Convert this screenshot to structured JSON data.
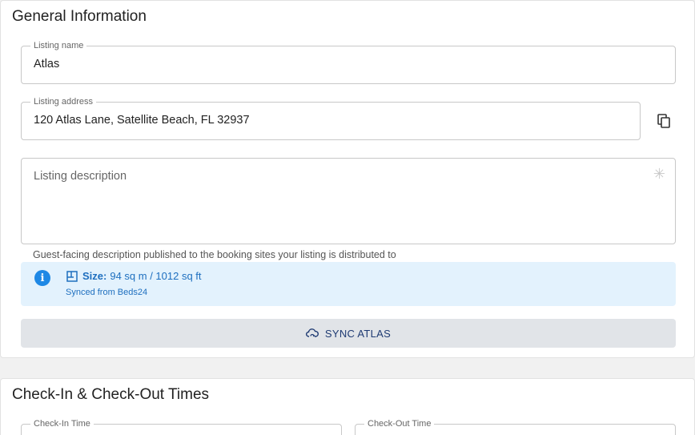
{
  "general": {
    "title": "General Information",
    "listing_name": {
      "label": "Listing name",
      "value": "Atlas"
    },
    "listing_address": {
      "label": "Listing address",
      "value": "120 Atlas Lane, Satellite Beach, FL 32937"
    },
    "listing_description": {
      "placeholder": "Listing description",
      "value": ""
    },
    "description_helper": "Guest-facing description published to the booking sites your listing is distributed to",
    "info": {
      "size_label": "Size:",
      "size_value": "94 sq m / 1012 sq ft",
      "synced": "Synced from Beds24"
    },
    "sync_button": "SYNC ATLAS"
  },
  "checkin": {
    "title": "Check-In & Check-Out Times",
    "checkin_label": "Check-In Time",
    "checkout_label": "Check-Out Time"
  },
  "colors": {
    "info_bg": "#e3f2fd",
    "info_accent": "#1e88e5",
    "sync_text": "#1f3b73",
    "sync_bg": "#e1e4e8"
  },
  "icons": [
    "copy-icon",
    "sparkle-icon",
    "info-icon",
    "floorplan-icon",
    "cloud-sync-icon"
  ]
}
